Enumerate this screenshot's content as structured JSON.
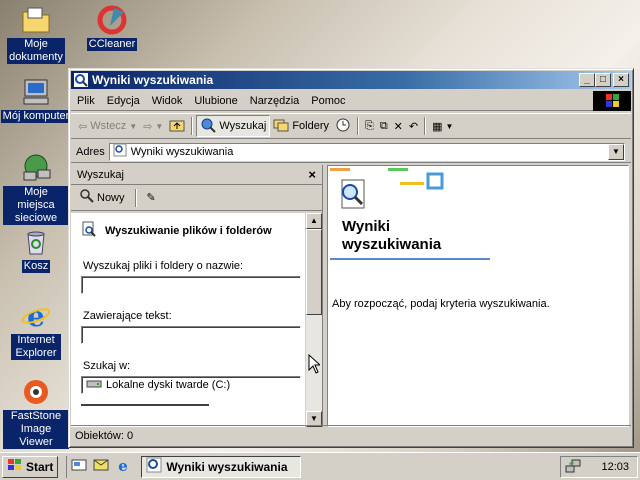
{
  "desktop": {
    "icons": [
      {
        "label": "Moje dokumenty",
        "icon": "folder-documents-icon"
      },
      {
        "label": "CCleaner",
        "icon": "ccleaner-icon"
      },
      {
        "label": "Mój komputer",
        "icon": "computer-icon"
      },
      {
        "label": "Moje miejsca sieciowe",
        "icon": "network-icon"
      },
      {
        "label": "Kosz",
        "icon": "recycle-bin-icon"
      },
      {
        "label": "Internet Explorer",
        "icon": "ie-icon"
      },
      {
        "label": "FastStone Image Viewer",
        "icon": "faststone-icon"
      }
    ]
  },
  "window": {
    "title": "Wyniki wyszukiwania",
    "buttons": {
      "minimize": "_",
      "maximize": "□",
      "close": "×"
    },
    "menu": [
      "Plik",
      "Edycja",
      "Widok",
      "Ulubione",
      "Narzędzia",
      "Pomoc"
    ],
    "toolbar": {
      "back": "Wstecz",
      "search": "Wyszukaj",
      "folders": "Foldery"
    },
    "address": {
      "label": "Adres",
      "value": "Wyniki wyszukiwania"
    },
    "search_pane": {
      "header": "Wyszukaj",
      "close": "×",
      "new_button": "Nowy",
      "title": "Wyszukiwanie plików i folderów",
      "name_label": "Wyszukaj pliki i foldery o nazwie:",
      "name_value": "",
      "text_label": "Zawierające tekst:",
      "text_value": "",
      "lookin_label": "Szukaj w:",
      "lookin_value": "Lokalne dyski twarde (C:)"
    },
    "results": {
      "title_line1": "Wyniki",
      "title_line2": "wyszukiwania",
      "message": "Aby rozpocząć, podaj kryteria wyszukiwania."
    },
    "status": "Obiektów: 0"
  },
  "taskbar": {
    "start": "Start",
    "task": "Wyniki wyszukiwania",
    "clock": "12:03"
  }
}
